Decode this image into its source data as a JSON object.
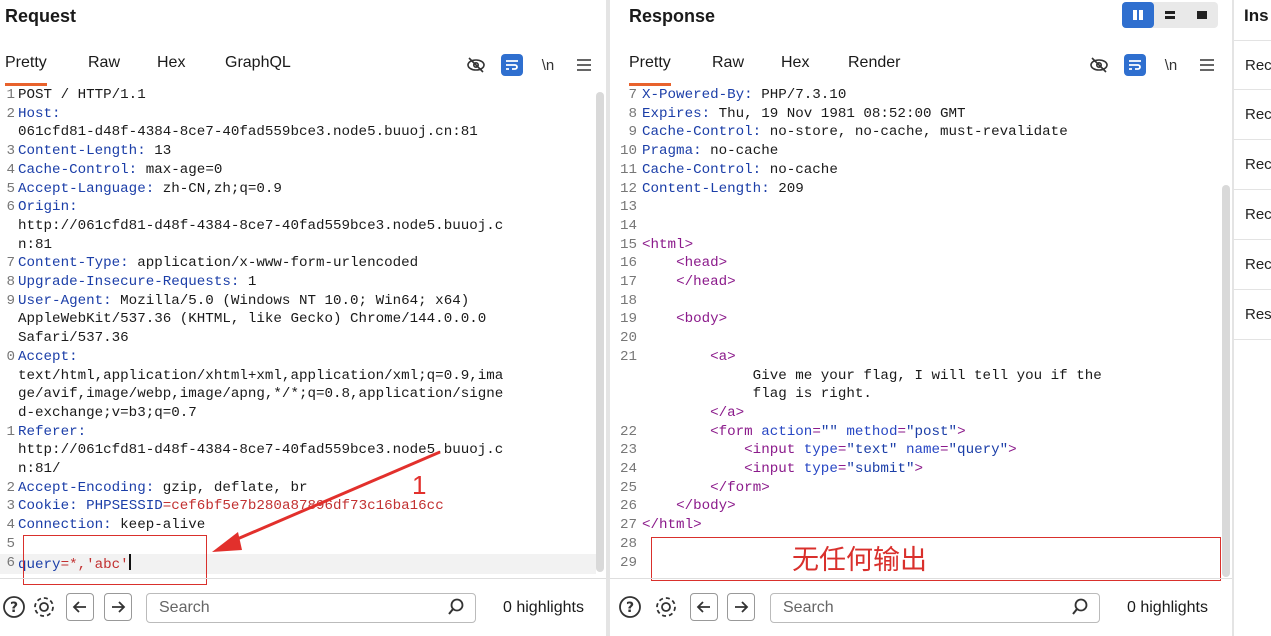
{
  "request": {
    "title": "Request",
    "tabs": [
      "Pretty",
      "Raw",
      "Hex",
      "GraphQL"
    ],
    "active_tab": "Pretty",
    "toolbar": {
      "eye_icon": "eye-off-icon",
      "wrap_icon": "wrap-icon",
      "newline_label": "\\n",
      "menu_icon": "hamburger-icon"
    },
    "lines": [
      {
        "n": "1",
        "k": "",
        "v": "POST / HTTP/1.1"
      },
      {
        "n": "2",
        "k": "Host:",
        "v": ""
      },
      {
        "n": "",
        "k": "",
        "v": "061cfd81-d48f-4384-8ce7-40fad559bce3.node5.buuoj.cn:81"
      },
      {
        "n": "3",
        "k": "Content-Length:",
        "v": " 13"
      },
      {
        "n": "4",
        "k": "Cache-Control:",
        "v": " max-age=0"
      },
      {
        "n": "5",
        "k": "Accept-Language:",
        "v": " zh-CN,zh;q=0.9"
      },
      {
        "n": "6",
        "k": "Origin:",
        "v": ""
      },
      {
        "n": "",
        "k": "",
        "v": "http://061cfd81-d48f-4384-8ce7-40fad559bce3.node5.buuoj.c"
      },
      {
        "n": "",
        "k": "",
        "v": "n:81"
      },
      {
        "n": "7",
        "k": "Content-Type:",
        "v": " application/x-www-form-urlencoded"
      },
      {
        "n": "8",
        "k": "Upgrade-Insecure-Requests:",
        "v": " 1"
      },
      {
        "n": "9",
        "k": "User-Agent:",
        "v": " Mozilla/5.0 (Windows NT 10.0; Win64; x64)"
      },
      {
        "n": "",
        "k": "",
        "v": "AppleWebKit/537.36 (KHTML, like Gecko) Chrome/144.0.0.0"
      },
      {
        "n": "",
        "k": "",
        "v": "Safari/537.36"
      },
      {
        "n": "0",
        "k": "Accept:",
        "v": ""
      },
      {
        "n": "",
        "k": "",
        "v": "text/html,application/xhtml+xml,application/xml;q=0.9,ima"
      },
      {
        "n": "",
        "k": "",
        "v": "ge/avif,image/webp,image/apng,*/*;q=0.8,application/signe"
      },
      {
        "n": "",
        "k": "",
        "v": "d-exchange;v=b3;q=0.7"
      },
      {
        "n": "1",
        "k": "Referer:",
        "v": ""
      },
      {
        "n": "",
        "k": "",
        "v": "http://061cfd81-d48f-4384-8ce7-40fad559bce3.node5.buuoj.c"
      },
      {
        "n": "",
        "k": "",
        "v": "n:81/"
      },
      {
        "n": "2",
        "k": "Accept-Encoding:",
        "v": " gzip, deflate, br"
      },
      {
        "n": "3",
        "k": "Cookie:",
        "v": " ",
        "ck": "PHPSESSID",
        "cv": "=cef6bf5e7b280a87896df73c16ba16cc"
      },
      {
        "n": "4",
        "k": "Connection:",
        "v": " keep-alive"
      },
      {
        "n": "5",
        "k": "",
        "v": ""
      },
      {
        "n": "6",
        "k": "",
        "v": "",
        "pk": "query",
        "pv": "=*,'abc'"
      }
    ],
    "footer": {
      "search_placeholder": "Search",
      "highlights": "0 highlights"
    },
    "annotation_number": "1"
  },
  "response": {
    "title": "Response",
    "tabs": [
      "Pretty",
      "Raw",
      "Hex",
      "Render"
    ],
    "active_tab": "Pretty",
    "lines": [
      {
        "n": "7",
        "k": "X-Powered-By:",
        "v": " PHP/7.3.10"
      },
      {
        "n": "8",
        "k": "Expires:",
        "v": " Thu, 19 Nov 1981 08:52:00 GMT"
      },
      {
        "n": "9",
        "k": "Cache-Control:",
        "v": " no-store, no-cache, must-revalidate"
      },
      {
        "n": "10",
        "k": "Pragma:",
        "v": " no-cache"
      },
      {
        "n": "11",
        "k": "Cache-Control:",
        "v": " no-cache"
      },
      {
        "n": "12",
        "k": "Content-Length:",
        "v": " 209"
      },
      {
        "n": "13",
        "k": "",
        "v": ""
      },
      {
        "n": "14",
        "k": "",
        "v": ""
      },
      {
        "n": "15",
        "html": "<html>",
        "indent": ""
      },
      {
        "n": "16",
        "html": "<head>",
        "indent": "    "
      },
      {
        "n": "17",
        "html": "</head>",
        "indent": "    "
      },
      {
        "n": "18",
        "k": "",
        "v": ""
      },
      {
        "n": "19",
        "html": "<body>",
        "indent": "    "
      },
      {
        "n": "20",
        "k": "",
        "v": ""
      },
      {
        "n": "21",
        "html": "<a>",
        "indent": "        "
      },
      {
        "n": "",
        "k": "",
        "v": "             Give me your flag, I will tell you if the"
      },
      {
        "n": "",
        "k": "",
        "v": "             flag is right."
      },
      {
        "n": "",
        "html": "</a>",
        "indent": "        "
      },
      {
        "n": "22",
        "form": true,
        "indent": "        "
      },
      {
        "n": "23",
        "input1": true,
        "indent": "            "
      },
      {
        "n": "24",
        "input2": true,
        "indent": "            "
      },
      {
        "n": "25",
        "html": "</form>",
        "indent": "        "
      },
      {
        "n": "26",
        "html": "</body>",
        "indent": "    "
      },
      {
        "n": "27",
        "html": "</html>",
        "indent": ""
      },
      {
        "n": "28",
        "k": "",
        "v": ""
      },
      {
        "n": "29",
        "k": "",
        "v": ""
      }
    ],
    "annotation_text": "无任何输出",
    "footer": {
      "search_placeholder": "Search",
      "highlights": "0 highlights"
    }
  },
  "inspector": {
    "title": "Ins",
    "rows": [
      "Rec",
      "Rec",
      "Rec",
      "Rec",
      "Rec",
      "Res"
    ]
  },
  "colors": {
    "accent": "#e8622c",
    "blue": "#2f6fcf",
    "annotation_red": "#d9302c"
  }
}
